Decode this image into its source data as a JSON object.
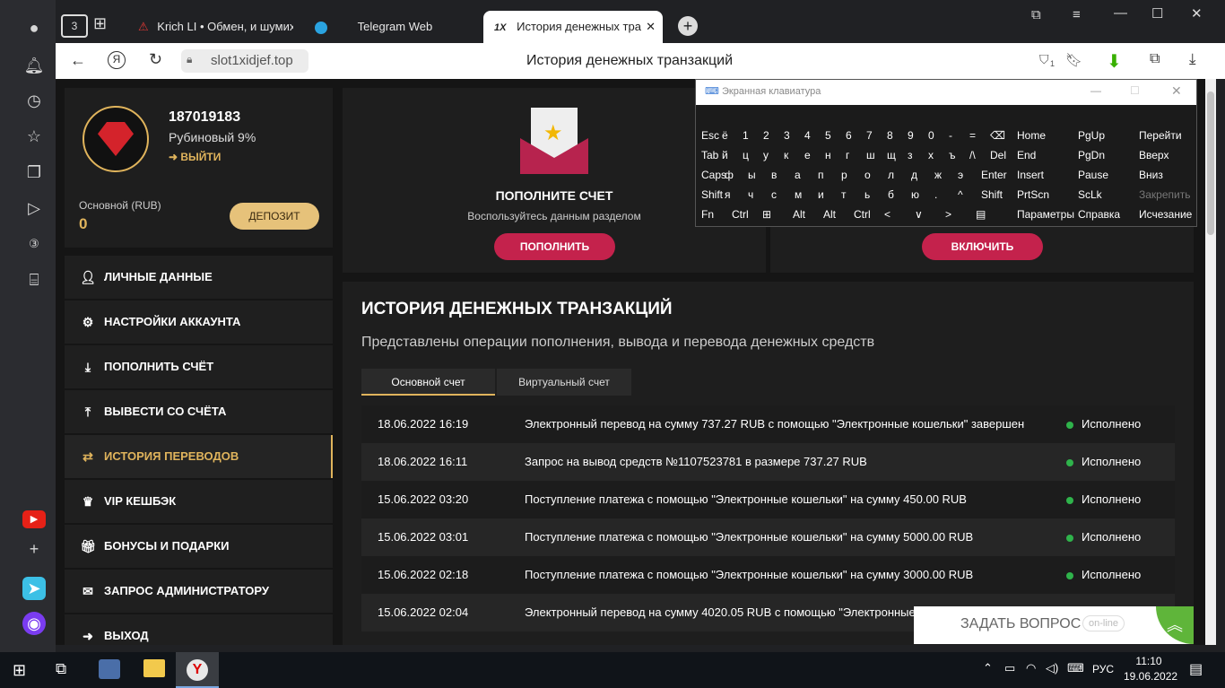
{
  "browser": {
    "tab_counter": "3",
    "tabs": [
      {
        "label": "Krich LI • Обмен, и шумиха"
      },
      {
        "label": "Telegram Web"
      },
      {
        "label": "История денежных тра"
      }
    ],
    "url": "slot1xidjef.top",
    "page_title": "История денежных транзакций",
    "notif_count": "1"
  },
  "profile": {
    "user_id": "187019183",
    "level": "Рубиновый 9%",
    "logout": "ВЫЙТИ",
    "balance_label": "Основной (RUB)",
    "balance": "0",
    "deposit_button": "ДЕПОЗИТ"
  },
  "menu": [
    {
      "label": "ЛИЧНЫЕ ДАННЫЕ",
      "icon": "user-plus-icon"
    },
    {
      "label": "НАСТРОЙКИ АККАУНТА",
      "icon": "gears-icon"
    },
    {
      "label": "ПОПОЛНИТЬ СЧЁТ",
      "icon": "download-icon"
    },
    {
      "label": "ВЫВЕСТИ СО СЧЁТА",
      "icon": "upload-icon"
    },
    {
      "label": "ИСТОРИЯ ПЕРЕВОДОВ",
      "icon": "arrows-icon",
      "active": true
    },
    {
      "label": "VIP КЕШБЭК",
      "icon": "crown-icon"
    },
    {
      "label": "БОНУСЫ И ПОДАРКИ",
      "icon": "gift-icon"
    },
    {
      "label": "ЗАПРОС АДМИНИСТРАТОРУ",
      "icon": "envelope-icon"
    },
    {
      "label": "ВЫХОД",
      "icon": "exit-icon"
    }
  ],
  "promo": {
    "title": "ПОПОЛНИТЕ СЧЕТ",
    "subtitle": "Воспользуйтесь данным разделом",
    "button": "ПОПОЛНИТЬ",
    "button2": "ВКЛЮЧИТЬ"
  },
  "history": {
    "title": "ИСТОРИЯ ДЕНЕЖНЫХ ТРАНЗАКЦИЙ",
    "subtitle": "Представлены операции пополнения, вывода и перевода денежных средств",
    "tabs": [
      "Основной счет",
      "Виртуальный счет"
    ],
    "rows": [
      {
        "date": "18.06.2022 16:19",
        "text": "Электронный перевод на сумму 737.27 RUB с помощью \"Электронные кошельки\" завершен",
        "status": "Исполнено"
      },
      {
        "date": "18.06.2022 16:11",
        "text": "Запрос на вывод средств №1107523781 в размере 737.27 RUB",
        "status": "Исполнено"
      },
      {
        "date": "15.06.2022 03:20",
        "text": "Поступление платежа с помощью \"Электронные кошельки\" на сумму 450.00 RUB",
        "status": "Исполнено"
      },
      {
        "date": "15.06.2022 03:01",
        "text": "Поступление платежа с помощью \"Электронные кошельки\" на сумму 5000.00 RUB",
        "status": "Исполнено"
      },
      {
        "date": "15.06.2022 02:18",
        "text": "Поступление платежа с помощью \"Электронные кошельки\" на сумму 3000.00 RUB",
        "status": "Исполнено"
      },
      {
        "date": "15.06.2022 02:04",
        "text": "Электронный перевод на сумму 4020.05 RUB с помощью \"Электронные",
        "status": ""
      }
    ]
  },
  "chat": {
    "label": "ЗАДАТЬ ВОПРОС",
    "status": "on-line"
  },
  "osk": {
    "title": "Экранная клавиатура",
    "row1": [
      "Esc",
      "ё",
      "1",
      "2",
      "3",
      "4",
      "5",
      "6",
      "7",
      "8",
      "9",
      "0",
      "-",
      "=",
      "⌫"
    ],
    "row2": [
      "Tab",
      "й",
      "ц",
      "у",
      "к",
      "е",
      "н",
      "г",
      "ш",
      "щ",
      "з",
      "х",
      "ъ",
      "/\\",
      "Del"
    ],
    "row3": [
      "Caps",
      "ф",
      "ы",
      "в",
      "а",
      "п",
      "р",
      "о",
      "л",
      "д",
      "ж",
      "э",
      "Enter"
    ],
    "row4": [
      "Shift",
      "я",
      "ч",
      "с",
      "м",
      "и",
      "т",
      "ь",
      "б",
      "ю",
      ".",
      "^",
      "Shift"
    ],
    "row5": [
      "Fn",
      "Ctrl",
      "⊞",
      "Alt",
      "Alt",
      "Ctrl",
      "<",
      "∨",
      ">",
      "▤"
    ],
    "nav": [
      "Home",
      "PgUp",
      "Перейти",
      "End",
      "PgDn",
      "Вверх",
      "Insert",
      "Pause",
      "Вниз",
      "PrtScn",
      "ScLk",
      "Закрепить",
      "Параметры",
      "Справка",
      "Исчезание"
    ]
  },
  "taskbar": {
    "lang": "РУС",
    "time": "11:10",
    "date": "19.06.2022"
  }
}
